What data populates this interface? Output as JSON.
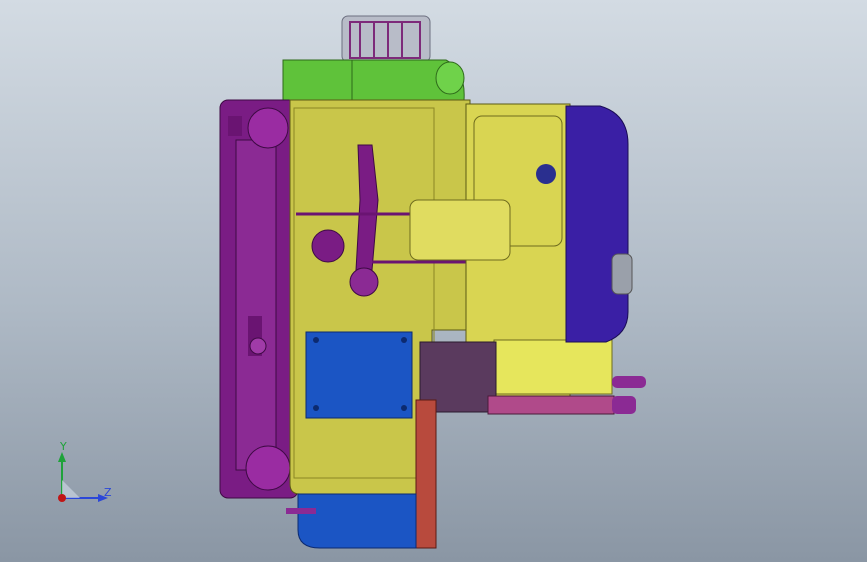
{
  "viewport": {
    "background_top": "#d3dbe3",
    "background_bottom": "#8a96a4"
  },
  "model": {
    "colors": {
      "purple": "#8b1f8f",
      "purple_dark": "#5a0f5e",
      "olive": "#c9c64a",
      "olive_dark": "#6f6c1e",
      "yellow": "#e6e65c",
      "green": "#5fc23a",
      "blue": "#1b55c4",
      "indigo": "#3a1fa5",
      "red": "#b84a3d",
      "gray": "#9aa0aa"
    }
  },
  "triad": {
    "y_label": "Y",
    "z_label": "Z",
    "y_color": "#1fa23a",
    "z_color": "#2b47d8",
    "origin_color": "#c01515"
  }
}
